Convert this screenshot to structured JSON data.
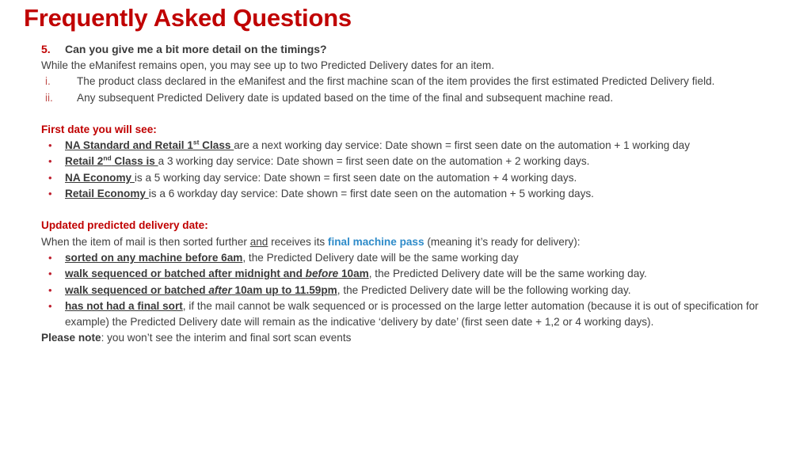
{
  "slide": {
    "title": "Frequently Asked Questions",
    "question": {
      "number": "5.",
      "text": "Can you give me a bit more detail on the timings?"
    },
    "intro": "While the eManifest remains open, you may see up to two Predicted Delivery dates for an item.",
    "roman_items": [
      {
        "marker": "i.",
        "text": "The product class declared in the eManifest and the first machine scan of the item provides the first estimated Predicted Delivery field."
      },
      {
        "marker": "ii.",
        "text": "Any subsequent Predicted Delivery date is updated based on the time of the final and subsequent machine read."
      }
    ],
    "section_one": {
      "heading": "First date you will see:",
      "bullet_marker": "•",
      "items": [
        {
          "lead_pre": "NA Standard and Retail 1",
          "lead_sup": "st",
          "lead_post": " Class ",
          "rest": "are a next working day service:  Date shown = first seen date on the automation + 1 working day"
        },
        {
          "lead_pre": "Retail 2",
          "lead_sup": "nd",
          "lead_post": " Class is ",
          "rest": "a 3 working day service:  Date shown  = first seen date on the automation + 2 working days."
        },
        {
          "lead_pre": "NA Economy ",
          "lead_sup": "",
          "lead_post": "",
          "rest": "is a 5 working day service: Date shown = first seen date on the automation + 4 working days."
        },
        {
          "lead_pre": "Retail Economy ",
          "lead_sup": "",
          "lead_post": "",
          "rest": "is a 6 workday day service:  Date shown = first date seen on the automation + 5 working days."
        }
      ]
    },
    "section_two": {
      "heading": "Updated predicted delivery date:",
      "bullet_marker": "•",
      "lead_line": {
        "part1": "When the item of mail is then sorted further ",
        "underlined": "and",
        "part2": " receives its ",
        "highlight": "final machine pass",
        "part3": " (meaning it’s ready for delivery):"
      },
      "items": [
        {
          "bold_a": "sorted on any machine before 6am",
          "italic": "",
          "bold_b": "",
          "rest": ", the Predicted Delivery date will be the same working day"
        },
        {
          "bold_a": "walk sequenced or batched after midnight and ",
          "italic": "before",
          "bold_b": "  10am",
          "rest": ",  the Predicted Delivery date will be the same working day."
        },
        {
          "bold_a": "walk sequenced or batched ",
          "italic": "after",
          "bold_b": " 10am up to 11.59pm",
          "rest": ", the Predicted Delivery date will be the following working day."
        },
        {
          "bold_a": "has not had a final sort",
          "italic": "",
          "bold_b": "",
          "rest": ", if the mail cannot be walk sequenced or is processed on the large letter automation (because it is out of specification for example) the Predicted Delivery date will remain as the indicative ‘delivery by date’ (first seen date + 1,2 or 4 working days)."
        }
      ],
      "note": {
        "bold": "Please note",
        "rest": ": you won’t see the interim and final sort scan events"
      }
    }
  }
}
